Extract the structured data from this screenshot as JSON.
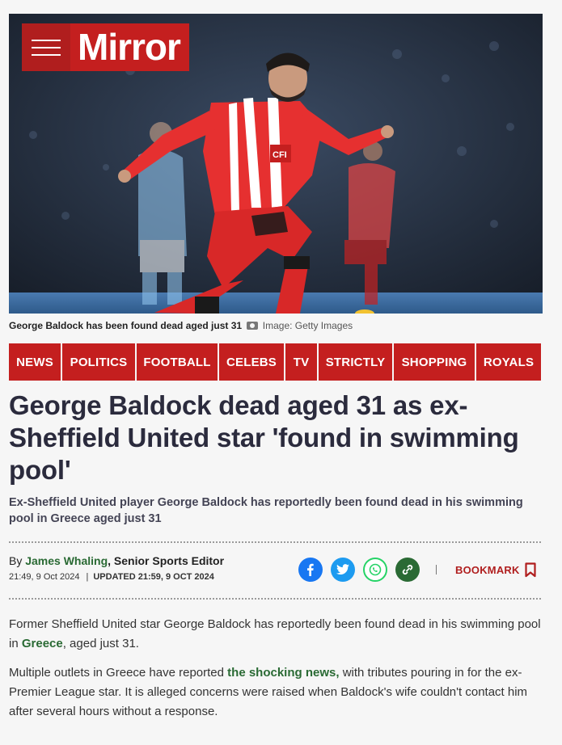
{
  "brand": {
    "logo_text": "Mirror",
    "color": "#c41f1f"
  },
  "hero": {
    "alt": "George Baldock in Sheffield United kit",
    "shirt_text": "CFI"
  },
  "caption": {
    "text": "George Baldock has been found dead aged just 31",
    "credit": "Image: Getty Images"
  },
  "nav": [
    "NEWS",
    "POLITICS",
    "FOOTBALL",
    "CELEBS",
    "TV",
    "STRICTLY",
    "SHOPPING",
    "ROYALS"
  ],
  "article": {
    "headline": "George Baldock dead aged 31 as ex-Sheffield United star 'found in swimming pool'",
    "standfirst": "Ex-Sheffield United player George Baldock has reportedly been found dead in his swimming pool in Greece aged just 31",
    "byline": {
      "prefix": "By",
      "author": "James Whaling",
      "role": ", Senior Sports Editor"
    },
    "published": "21:49, 9 Oct 2024",
    "updated": "UPDATED 21:59, 9 OCT 2024",
    "bookmark_label": "BOOKMARK",
    "paragraphs": [
      {
        "before": "Former Sheffield United star George Baldock has reportedly been found dead in his swimming pool in ",
        "link": "Greece",
        "after": ", aged just 31."
      },
      {
        "before": "Multiple outlets in Greece have reported ",
        "link": "the shocking news,",
        "after": " with tributes pouring in for the ex-Premier League star. It is alleged concerns were raised when Baldock's wife couldn't contact him after several hours without a response."
      }
    ]
  },
  "share": [
    {
      "name": "facebook",
      "color": "#1877f2"
    },
    {
      "name": "twitter",
      "color": "#1d9bf0"
    },
    {
      "name": "whatsapp",
      "color": "#25d366"
    },
    {
      "name": "copy-link",
      "color": "#2a6a34"
    }
  ]
}
